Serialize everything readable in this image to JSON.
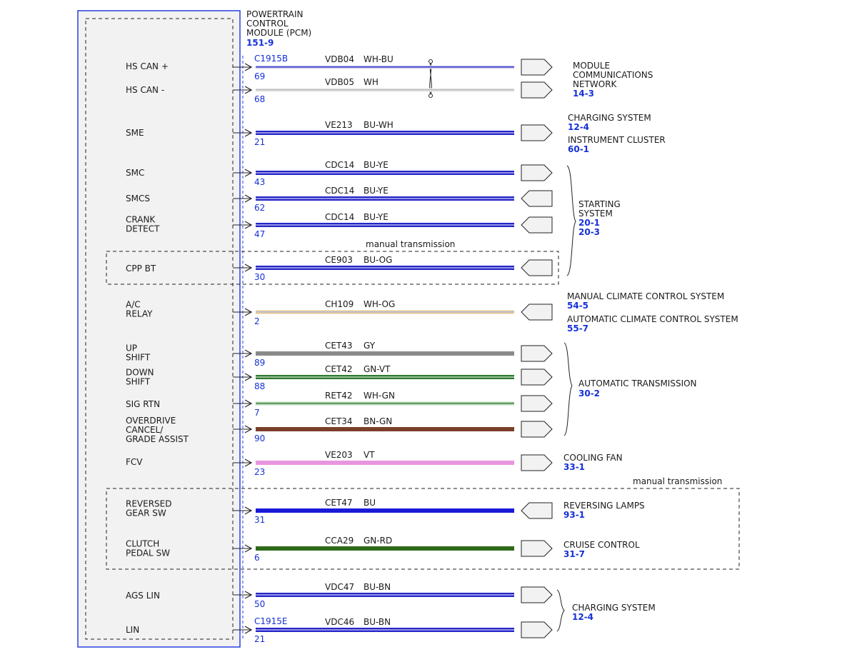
{
  "module": {
    "title_lines": [
      "POWERTRAIN",
      "CONTROL",
      "MODULE (PCM)"
    ],
    "ref": "151-9",
    "colors": {
      "frame": "#2a3fe0",
      "fill": "#f2f2f2",
      "ref": "#1530d8"
    }
  },
  "connectors": {
    "top": "C1915B",
    "bottom": "C1915E"
  },
  "notes": {
    "manual_transmission": "manual transmission"
  },
  "pins": [
    {
      "label_lines": [
        "HS CAN +"
      ],
      "pin": "69",
      "circuit": "VDB04",
      "color_code": "WH-BU",
      "colors": [
        "#d8d8ec",
        "#2a2ad0"
      ],
      "style": "thin",
      "arrow": "right"
    },
    {
      "label_lines": [
        "HS CAN -"
      ],
      "pin": "68",
      "circuit": "VDB05",
      "color_code": "WH",
      "colors": [
        "#e8e8e8",
        "#b8b8b8"
      ],
      "style": "thin",
      "arrow": "right"
    },
    {
      "label_lines": [
        "SME"
      ],
      "pin": "21",
      "circuit": "VE213",
      "color_code": "BU-WH",
      "colors": [
        "#2525c8",
        "#ffffff"
      ],
      "style": "thick",
      "arrow": "right"
    },
    {
      "label_lines": [
        "SMC"
      ],
      "pin": "43",
      "circuit": "CDC14",
      "color_code": "BU-YE",
      "colors": [
        "#2525c8",
        "#ffffff"
      ],
      "style": "thick",
      "arrow": "right"
    },
    {
      "label_lines": [
        "SMCS"
      ],
      "pin": "62",
      "circuit": "CDC14",
      "color_code": "BU-YE",
      "colors": [
        "#2525c8",
        "#ffffff"
      ],
      "style": "thick",
      "arrow": "left"
    },
    {
      "label_lines": [
        "CRANK",
        "DETECT"
      ],
      "pin": "47",
      "circuit": "CDC14",
      "color_code": "BU-YE",
      "colors": [
        "#2525c8",
        "#ffffff"
      ],
      "style": "thick",
      "arrow": "left"
    },
    {
      "label_lines": [
        "CPP BT"
      ],
      "pin": "30",
      "circuit": "CE903",
      "color_code": "BU-OG",
      "colors": [
        "#2525c8",
        "#ffffff"
      ],
      "style": "thick",
      "arrow": "left"
    },
    {
      "label_lines": [
        "A/C",
        "RELAY"
      ],
      "pin": "2",
      "circuit": "CH109",
      "color_code": "WH-OG",
      "colors": [
        "#f0c890",
        "#a8c0e0"
      ],
      "style": "thin",
      "arrow": "left"
    },
    {
      "label_lines": [
        "UP",
        "SHIFT"
      ],
      "pin": "89",
      "circuit": "CET43",
      "color_code": "GY",
      "colors": [
        "#8a8a8a"
      ],
      "style": "solid",
      "arrow": "right"
    },
    {
      "label_lines": [
        "DOWN",
        "SHIFT"
      ],
      "pin": "88",
      "circuit": "CET42",
      "color_code": "GN-VT",
      "colors": [
        "#2f7a2f",
        "#ffffff"
      ],
      "style": "thick",
      "arrow": "right"
    },
    {
      "label_lines": [
        "SIG RTN"
      ],
      "pin": "7",
      "circuit": "RET42",
      "color_code": "WH-GN",
      "colors": [
        "#b8d8b8",
        "#4a8a4a"
      ],
      "style": "thin",
      "arrow": "right"
    },
    {
      "label_lines": [
        "OVERDRIVE",
        "CANCEL/",
        "GRADE ASSIST"
      ],
      "pin": "90",
      "circuit": "CET34",
      "color_code": "BN-GN",
      "colors": [
        "#7a3f2a"
      ],
      "style": "solid",
      "arrow": "right"
    },
    {
      "label_lines": [
        "FCV"
      ],
      "pin": "23",
      "circuit": "VE203",
      "color_code": "VT",
      "colors": [
        "#e895e0"
      ],
      "style": "solid",
      "arrow": "right"
    },
    {
      "label_lines": [
        "REVERSED",
        "GEAR SW"
      ],
      "pin": "31",
      "circuit": "CET47",
      "color_code": "BU",
      "colors": [
        "#1a1ad8"
      ],
      "style": "solid",
      "arrow": "left"
    },
    {
      "label_lines": [
        "CLUTCH",
        "PEDAL SW"
      ],
      "pin": "6",
      "circuit": "CCA29",
      "color_code": "GN-RD",
      "colors": [
        "#2f6a1a"
      ],
      "style": "solid",
      "arrow": "right"
    },
    {
      "label_lines": [
        "AGS LIN"
      ],
      "pin": "50",
      "circuit": "VDC47",
      "color_code": "BU-BN",
      "colors": [
        "#2525c8",
        "#ffffff"
      ],
      "style": "thick",
      "arrow": "right"
    },
    {
      "label_lines": [
        "LIN"
      ],
      "pin": "21",
      "circuit": "VDC46",
      "color_code": "BU-BN",
      "colors": [
        "#2525c8",
        "#ffffff"
      ],
      "style": "thick",
      "arrow": "right"
    }
  ],
  "destinations": [
    {
      "name_lines": [
        "MODULE",
        "COMMUNICATIONS",
        "NETWORK"
      ],
      "ref": "14-3"
    },
    {
      "name_lines": [
        "CHARGING SYSTEM"
      ],
      "ref": "12-4"
    },
    {
      "name_lines": [
        "INSTRUMENT CLUSTER"
      ],
      "ref": "60-1"
    },
    {
      "name_lines": [
        "STARTING",
        "SYSTEM"
      ],
      "ref": "20-1",
      "ref2": "20-3"
    },
    {
      "name_lines": [
        "MANUAL CLIMATE CONTROL SYSTEM"
      ],
      "ref": "54-5"
    },
    {
      "name_lines": [
        "AUTOMATIC CLIMATE CONTROL SYSTEM"
      ],
      "ref": "55-7"
    },
    {
      "name_lines": [
        "AUTOMATIC TRANSMISSION"
      ],
      "ref": "30-2"
    },
    {
      "name_lines": [
        "COOLING FAN"
      ],
      "ref": "33-1"
    },
    {
      "name_lines": [
        "REVERSING LAMPS"
      ],
      "ref": "93-1"
    },
    {
      "name_lines": [
        "CRUISE CONTROL"
      ],
      "ref": "31-7"
    },
    {
      "name_lines": [
        "CHARGING SYSTEM"
      ],
      "ref": "12-4"
    }
  ]
}
